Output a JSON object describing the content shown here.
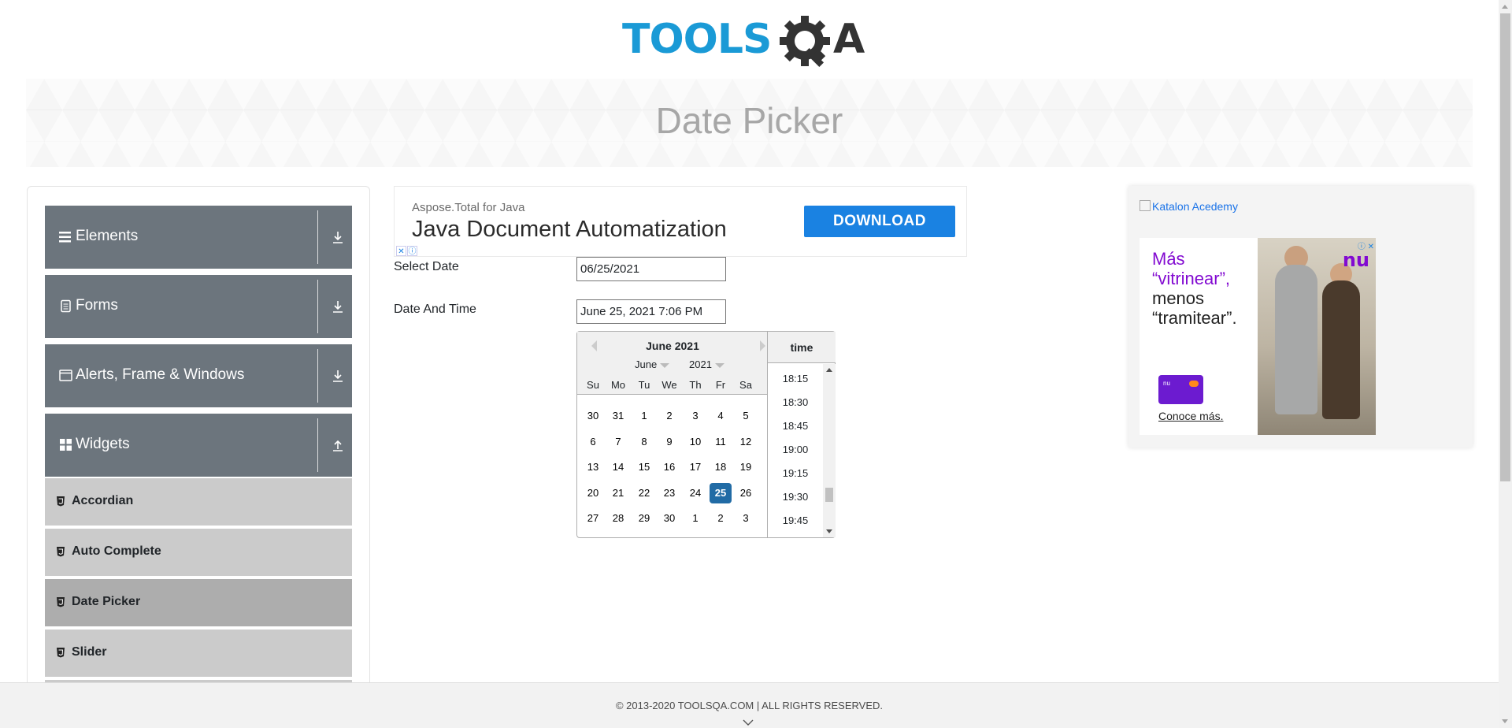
{
  "site": {
    "logo_text": "TOOLSQA",
    "page_title": "Date Picker"
  },
  "sidebar": {
    "groups": [
      {
        "label": "Elements",
        "icon": "hamburger-icon",
        "expanded": false
      },
      {
        "label": "Forms",
        "icon": "document-icon",
        "expanded": false
      },
      {
        "label": "Alerts, Frame & Windows",
        "icon": "window-icon",
        "expanded": false
      },
      {
        "label": "Widgets",
        "icon": "grid-icon",
        "expanded": true
      }
    ],
    "items": [
      {
        "label": "Accordian",
        "active": false
      },
      {
        "label": "Auto Complete",
        "active": false
      },
      {
        "label": "Date Picker",
        "active": true
      },
      {
        "label": "Slider",
        "active": false
      }
    ]
  },
  "ad_top": {
    "brand": "Aspose.Total for Java",
    "headline": "Java Document Automatization",
    "button": "DOWNLOAD"
  },
  "form": {
    "select_date_label": "Select Date",
    "select_date_value": "06/25/2021",
    "date_time_label": "Date And Time",
    "date_time_value": "June 25, 2021 7:06 PM"
  },
  "datepicker": {
    "title": "June 2021",
    "month_select": "June",
    "year_select": "2021",
    "weekdays": [
      "Su",
      "Mo",
      "Tu",
      "We",
      "Th",
      "Fr",
      "Sa"
    ],
    "weeks": [
      [
        "30",
        "31",
        "1",
        "2",
        "3",
        "4",
        "5"
      ],
      [
        "6",
        "7",
        "8",
        "9",
        "10",
        "11",
        "12"
      ],
      [
        "13",
        "14",
        "15",
        "16",
        "17",
        "18",
        "19"
      ],
      [
        "20",
        "21",
        "22",
        "23",
        "24",
        "25",
        "26"
      ],
      [
        "27",
        "28",
        "29",
        "30",
        "1",
        "2",
        "3"
      ]
    ],
    "selected_day": "25",
    "time_header": "time",
    "times": [
      "18:15",
      "18:30",
      "18:45",
      "19:00",
      "19:15",
      "19:30",
      "19:45"
    ]
  },
  "ad_right": {
    "broken_image_alt": "Katalon Acedemy",
    "line1": "Más",
    "line2": "“vitrinear”,",
    "line3": "menos",
    "line4": "“tramitear”.",
    "card_text": "nu",
    "cta": "Conoce más.",
    "brand": "nu"
  },
  "footer": {
    "copyright": "© 2013-2020 TOOLSQA.COM | ALL RIGHTS RESERVED."
  },
  "colors": {
    "brand_blue": "#1a9ad6",
    "sidebar_group": "#6c757d",
    "sidebar_item": "#cbcbcb",
    "sidebar_item_active": "#adadad",
    "selected_day": "#216ba5",
    "download_button": "#1a82e2",
    "nu_purple": "#820ad1"
  }
}
